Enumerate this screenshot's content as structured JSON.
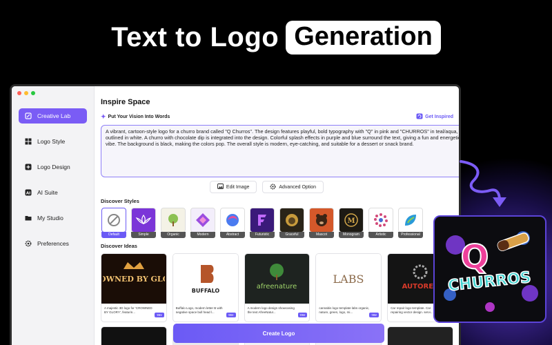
{
  "headline": {
    "plain": "Text to Logo",
    "pill": "Generation"
  },
  "sidebar": {
    "items": [
      {
        "label": "Creative Lab",
        "icon": "edit-icon",
        "active": true
      },
      {
        "label": "Logo Style",
        "icon": "grid-icon",
        "active": false
      },
      {
        "label": "Logo Design",
        "icon": "plus-square-icon",
        "active": false
      },
      {
        "label": "AI Suite",
        "icon": "ai-icon",
        "active": false
      },
      {
        "label": "My Studio",
        "icon": "folder-icon",
        "active": false
      },
      {
        "label": "Preferences",
        "icon": "gear-icon",
        "active": false
      }
    ]
  },
  "main": {
    "title": "Inspire Space",
    "vision_label": "Put Your Vision Into Words",
    "get_inspired": "Get Inspired",
    "prompt": "A vibrant, cartoon-style logo for a churro brand called \"Q Churros\". The design  features playful, bold typography with \"Q\" in pink and \"CHURROS\" in teal/aqua, outlined in white. A churro with chocolate dip is integrated into the design. Colorful splash effects in purple and blue surround the text, giving a fun and energetic vibe. The background is black, making the colors pop. The overall style is modern, eye-catching, and suitable for a dessert or snack brand.",
    "edit_image": "Edit Image",
    "advanced_option": "Advanced Option",
    "discover_styles": "Discover Styles",
    "styles": [
      "Default",
      "Simple",
      "Organic",
      "Modern",
      "Abstract",
      "Futuristic",
      "Graceful",
      "Mascot",
      "Monogram",
      "Artistic",
      "Professional"
    ],
    "discover_ideas": "Discover Ideas",
    "ideas": [
      {
        "caption": "A majestic 3D logo for 'CROWNED BY GLORY', featurin...",
        "try": "TRY",
        "art": "CROWNED BY GLORY"
      },
      {
        "caption": "Buffalo Logo, modern letter B with negative space bull head l...",
        "try": "TRY",
        "art": "BUFFALO"
      },
      {
        "caption": "A modern logo design showcasing the text AfreeNatur...",
        "try": "TRY",
        "art": "afreenature"
      },
      {
        "caption": "cannabis logo template labs organic, nature, green, logo, mi...",
        "try": "TRY",
        "art": "LABS"
      },
      {
        "caption": "Car repair logo template. Car repairing vector design. servi...",
        "try": "TRY",
        "art": "AUTOREP"
      }
    ],
    "create_logo": "Create Logo"
  },
  "result": {
    "q": "Q",
    "brand": "CHURROS"
  },
  "colors": {
    "accent": "#6b5af5",
    "sidebar_bg": "#f3f3f5",
    "glow": "#6e46ff"
  }
}
